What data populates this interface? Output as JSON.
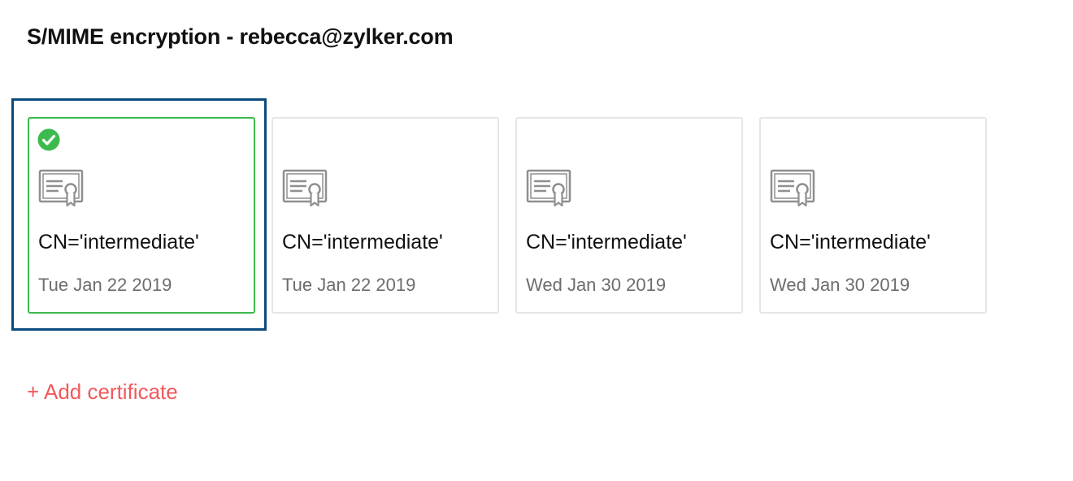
{
  "header": {
    "title": "S/MIME encryption - rebecca@zylker.com"
  },
  "certificates": [
    {
      "name": "CN='intermediate'",
      "date": "Tue Jan 22 2019",
      "selected": true,
      "icon": "certificate-icon"
    },
    {
      "name": "CN='intermediate'",
      "date": "Tue Jan 22 2019",
      "selected": false,
      "icon": "certificate-icon"
    },
    {
      "name": "CN='intermediate'",
      "date": "Wed Jan 30 2019",
      "selected": false,
      "icon": "certificate-icon"
    },
    {
      "name": "CN='intermediate'",
      "date": "Wed Jan 30 2019",
      "selected": false,
      "icon": "certificate-icon"
    }
  ],
  "actions": {
    "add_certificate_label": "+ Add certificate"
  },
  "colors": {
    "selected_border": "#3dba4e",
    "check": "#3dba4e",
    "focus_ring": "#0b4a7c",
    "add_link": "#f0595c",
    "icon": "#8f8f8f"
  }
}
